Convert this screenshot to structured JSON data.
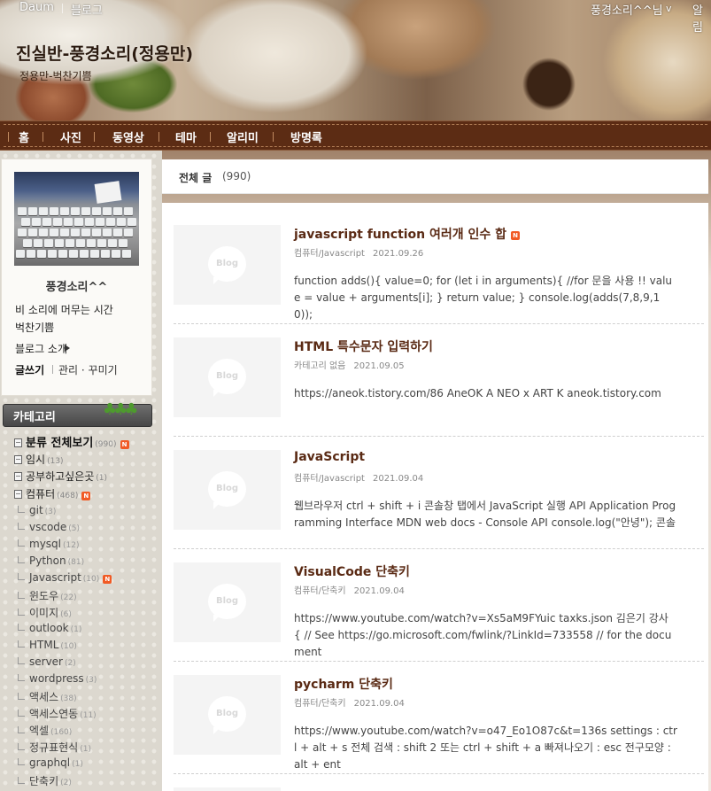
{
  "topbar": {
    "daum": "Daum",
    "blog": "블로그",
    "user": "풍경소리^^님",
    "user_caret": "v",
    "alarm": "알림"
  },
  "blog": {
    "title": "진실반-풍경소리(정용만)",
    "subtitle": "정용만-벅찬기쁨"
  },
  "nav": {
    "items": [
      "홈",
      "사진",
      "동영상",
      "테마",
      "알리미",
      "방명록"
    ]
  },
  "profile": {
    "name": "풍경소리^^",
    "desc1": "비 소리에 머무는 시간",
    "desc2": "벅찬기쁨",
    "intro": "블로그 소개",
    "write": "글쓰기",
    "manage": "관리 · 꾸미기",
    "photo_icon": "keyboard-photo"
  },
  "category": {
    "title": "카테고리",
    "top": [
      {
        "name": "분류 전체보기",
        "count": "(990)",
        "new": "N"
      },
      {
        "name": "임시",
        "count": "(13)"
      },
      {
        "name": "공부하고싶은곳",
        "count": "(1)"
      },
      {
        "name": "컴퓨터",
        "count": "(468)",
        "new": "N"
      }
    ],
    "sub": [
      {
        "name": "git",
        "count": "(3)"
      },
      {
        "name": "vscode",
        "count": "(5)"
      },
      {
        "name": "mysql",
        "count": "(12)"
      },
      {
        "name": "Python",
        "count": "(81)"
      },
      {
        "name": "Javascript",
        "count": "(10)",
        "new": "N"
      },
      {
        "name": "윈도우",
        "count": "(22)"
      },
      {
        "name": "이미지",
        "count": "(6)"
      },
      {
        "name": "outlook",
        "count": "(1)"
      },
      {
        "name": "HTML",
        "count": "(10)"
      },
      {
        "name": "server",
        "count": "(2)"
      },
      {
        "name": "wordpress",
        "count": "(3)"
      },
      {
        "name": "액세스",
        "count": "(38)"
      },
      {
        "name": "액세스연동",
        "count": "(11)"
      },
      {
        "name": "엑셀",
        "count": "(160)"
      },
      {
        "name": "정규표현식",
        "count": "(1)"
      },
      {
        "name": "graphql",
        "count": "(1)"
      },
      {
        "name": "단축키",
        "count": "(2)"
      }
    ]
  },
  "list": {
    "title": "전체 글",
    "count": "(990)",
    "thumb_label": "Blog",
    "posts": [
      {
        "title": "javascript function 여러개 인수 합",
        "new": "N",
        "category": "컴퓨터/Javascript",
        "date": "2021.09.26",
        "excerpt": "function adds(){ value=0; for (let i in arguments){ //for 문을 사용 !! value = value + arguments[i]; } return value; } console.log(adds(7,8,9,10));"
      },
      {
        "title": "HTML 특수문자 입력하기",
        "category": "카테고리 없음",
        "date": "2021.09.05",
        "excerpt": "https://aneok.tistory.com/86 AneOK A NEO x ART K aneok.tistory.com"
      },
      {
        "title": "JavaScript",
        "category": "컴퓨터/Javascript",
        "date": "2021.09.04",
        "excerpt": "웹브라우저 ctrl + shift + i 콘솔창 탭에서 JavaScript 실행 API Application Programming Interface MDN web docs - Console API console.log(\"안녕\"); 콘솔"
      },
      {
        "title": "VisualCode 단축키",
        "category": "컴퓨터/단축키",
        "date": "2021.09.04",
        "excerpt": "https://www.youtube.com/watch?v=Xs5aM9FYuic taxks.json 김은기 강사 { // See https://go.microsoft.com/fwlink/?LinkId=733558 // for the document"
      },
      {
        "title": "pycharm 단축키",
        "category": "컴퓨터/단축키",
        "date": "2021.09.04",
        "excerpt": "https://www.youtube.com/watch?v=o47_Eo1O87c&t=136s settings : ctrl + alt + s 전체 검색 : shift 2 또는 ctrl + shift + a 빠져나오기 : esc 전구모양 : alt + ent"
      }
    ]
  },
  "colors": {
    "nav_bg": "#5c2c14",
    "post_title": "#5a2a14",
    "new_badge": "#f15a24"
  }
}
